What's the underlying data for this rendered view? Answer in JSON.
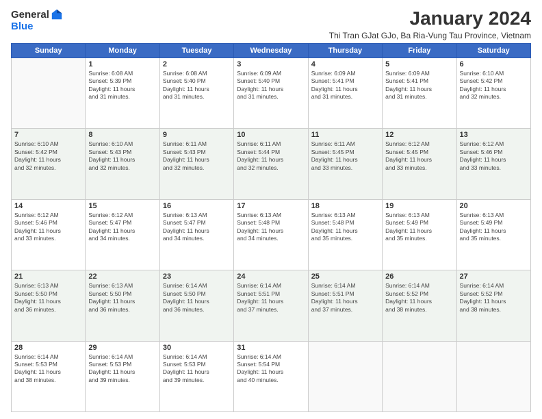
{
  "logo": {
    "general": "General",
    "blue": "Blue"
  },
  "title": "January 2024",
  "subtitle": "Thi Tran GJat GJo, Ba Ria-Vung Tau Province, Vietnam",
  "days_of_week": [
    "Sunday",
    "Monday",
    "Tuesday",
    "Wednesday",
    "Thursday",
    "Friday",
    "Saturday"
  ],
  "weeks": [
    [
      {
        "day": "",
        "sunrise": "",
        "sunset": "",
        "daylight": ""
      },
      {
        "day": "1",
        "sunrise": "Sunrise: 6:08 AM",
        "sunset": "Sunset: 5:39 PM",
        "daylight": "Daylight: 11 hours and 31 minutes."
      },
      {
        "day": "2",
        "sunrise": "Sunrise: 6:08 AM",
        "sunset": "Sunset: 5:40 PM",
        "daylight": "Daylight: 11 hours and 31 minutes."
      },
      {
        "day": "3",
        "sunrise": "Sunrise: 6:09 AM",
        "sunset": "Sunset: 5:40 PM",
        "daylight": "Daylight: 11 hours and 31 minutes."
      },
      {
        "day": "4",
        "sunrise": "Sunrise: 6:09 AM",
        "sunset": "Sunset: 5:41 PM",
        "daylight": "Daylight: 11 hours and 31 minutes."
      },
      {
        "day": "5",
        "sunrise": "Sunrise: 6:09 AM",
        "sunset": "Sunset: 5:41 PM",
        "daylight": "Daylight: 11 hours and 31 minutes."
      },
      {
        "day": "6",
        "sunrise": "Sunrise: 6:10 AM",
        "sunset": "Sunset: 5:42 PM",
        "daylight": "Daylight: 11 hours and 32 minutes."
      }
    ],
    [
      {
        "day": "7",
        "sunrise": "Sunrise: 6:10 AM",
        "sunset": "Sunset: 5:42 PM",
        "daylight": "Daylight: 11 hours and 32 minutes."
      },
      {
        "day": "8",
        "sunrise": "Sunrise: 6:10 AM",
        "sunset": "Sunset: 5:43 PM",
        "daylight": "Daylight: 11 hours and 32 minutes."
      },
      {
        "day": "9",
        "sunrise": "Sunrise: 6:11 AM",
        "sunset": "Sunset: 5:43 PM",
        "daylight": "Daylight: 11 hours and 32 minutes."
      },
      {
        "day": "10",
        "sunrise": "Sunrise: 6:11 AM",
        "sunset": "Sunset: 5:44 PM",
        "daylight": "Daylight: 11 hours and 32 minutes."
      },
      {
        "day": "11",
        "sunrise": "Sunrise: 6:11 AM",
        "sunset": "Sunset: 5:45 PM",
        "daylight": "Daylight: 11 hours and 33 minutes."
      },
      {
        "day": "12",
        "sunrise": "Sunrise: 6:12 AM",
        "sunset": "Sunset: 5:45 PM",
        "daylight": "Daylight: 11 hours and 33 minutes."
      },
      {
        "day": "13",
        "sunrise": "Sunrise: 6:12 AM",
        "sunset": "Sunset: 5:46 PM",
        "daylight": "Daylight: 11 hours and 33 minutes."
      }
    ],
    [
      {
        "day": "14",
        "sunrise": "Sunrise: 6:12 AM",
        "sunset": "Sunset: 5:46 PM",
        "daylight": "Daylight: 11 hours and 33 minutes."
      },
      {
        "day": "15",
        "sunrise": "Sunrise: 6:12 AM",
        "sunset": "Sunset: 5:47 PM",
        "daylight": "Daylight: 11 hours and 34 minutes."
      },
      {
        "day": "16",
        "sunrise": "Sunrise: 6:13 AM",
        "sunset": "Sunset: 5:47 PM",
        "daylight": "Daylight: 11 hours and 34 minutes."
      },
      {
        "day": "17",
        "sunrise": "Sunrise: 6:13 AM",
        "sunset": "Sunset: 5:48 PM",
        "daylight": "Daylight: 11 hours and 34 minutes."
      },
      {
        "day": "18",
        "sunrise": "Sunrise: 6:13 AM",
        "sunset": "Sunset: 5:48 PM",
        "daylight": "Daylight: 11 hours and 35 minutes."
      },
      {
        "day": "19",
        "sunrise": "Sunrise: 6:13 AM",
        "sunset": "Sunset: 5:49 PM",
        "daylight": "Daylight: 11 hours and 35 minutes."
      },
      {
        "day": "20",
        "sunrise": "Sunrise: 6:13 AM",
        "sunset": "Sunset: 5:49 PM",
        "daylight": "Daylight: 11 hours and 35 minutes."
      }
    ],
    [
      {
        "day": "21",
        "sunrise": "Sunrise: 6:13 AM",
        "sunset": "Sunset: 5:50 PM",
        "daylight": "Daylight: 11 hours and 36 minutes."
      },
      {
        "day": "22",
        "sunrise": "Sunrise: 6:13 AM",
        "sunset": "Sunset: 5:50 PM",
        "daylight": "Daylight: 11 hours and 36 minutes."
      },
      {
        "day": "23",
        "sunrise": "Sunrise: 6:14 AM",
        "sunset": "Sunset: 5:50 PM",
        "daylight": "Daylight: 11 hours and 36 minutes."
      },
      {
        "day": "24",
        "sunrise": "Sunrise: 6:14 AM",
        "sunset": "Sunset: 5:51 PM",
        "daylight": "Daylight: 11 hours and 37 minutes."
      },
      {
        "day": "25",
        "sunrise": "Sunrise: 6:14 AM",
        "sunset": "Sunset: 5:51 PM",
        "daylight": "Daylight: 11 hours and 37 minutes."
      },
      {
        "day": "26",
        "sunrise": "Sunrise: 6:14 AM",
        "sunset": "Sunset: 5:52 PM",
        "daylight": "Daylight: 11 hours and 38 minutes."
      },
      {
        "day": "27",
        "sunrise": "Sunrise: 6:14 AM",
        "sunset": "Sunset: 5:52 PM",
        "daylight": "Daylight: 11 hours and 38 minutes."
      }
    ],
    [
      {
        "day": "28",
        "sunrise": "Sunrise: 6:14 AM",
        "sunset": "Sunset: 5:53 PM",
        "daylight": "Daylight: 11 hours and 38 minutes."
      },
      {
        "day": "29",
        "sunrise": "Sunrise: 6:14 AM",
        "sunset": "Sunset: 5:53 PM",
        "daylight": "Daylight: 11 hours and 39 minutes."
      },
      {
        "day": "30",
        "sunrise": "Sunrise: 6:14 AM",
        "sunset": "Sunset: 5:53 PM",
        "daylight": "Daylight: 11 hours and 39 minutes."
      },
      {
        "day": "31",
        "sunrise": "Sunrise: 6:14 AM",
        "sunset": "Sunset: 5:54 PM",
        "daylight": "Daylight: 11 hours and 40 minutes."
      },
      {
        "day": "",
        "sunrise": "",
        "sunset": "",
        "daylight": ""
      },
      {
        "day": "",
        "sunrise": "",
        "sunset": "",
        "daylight": ""
      },
      {
        "day": "",
        "sunrise": "",
        "sunset": "",
        "daylight": ""
      }
    ]
  ]
}
